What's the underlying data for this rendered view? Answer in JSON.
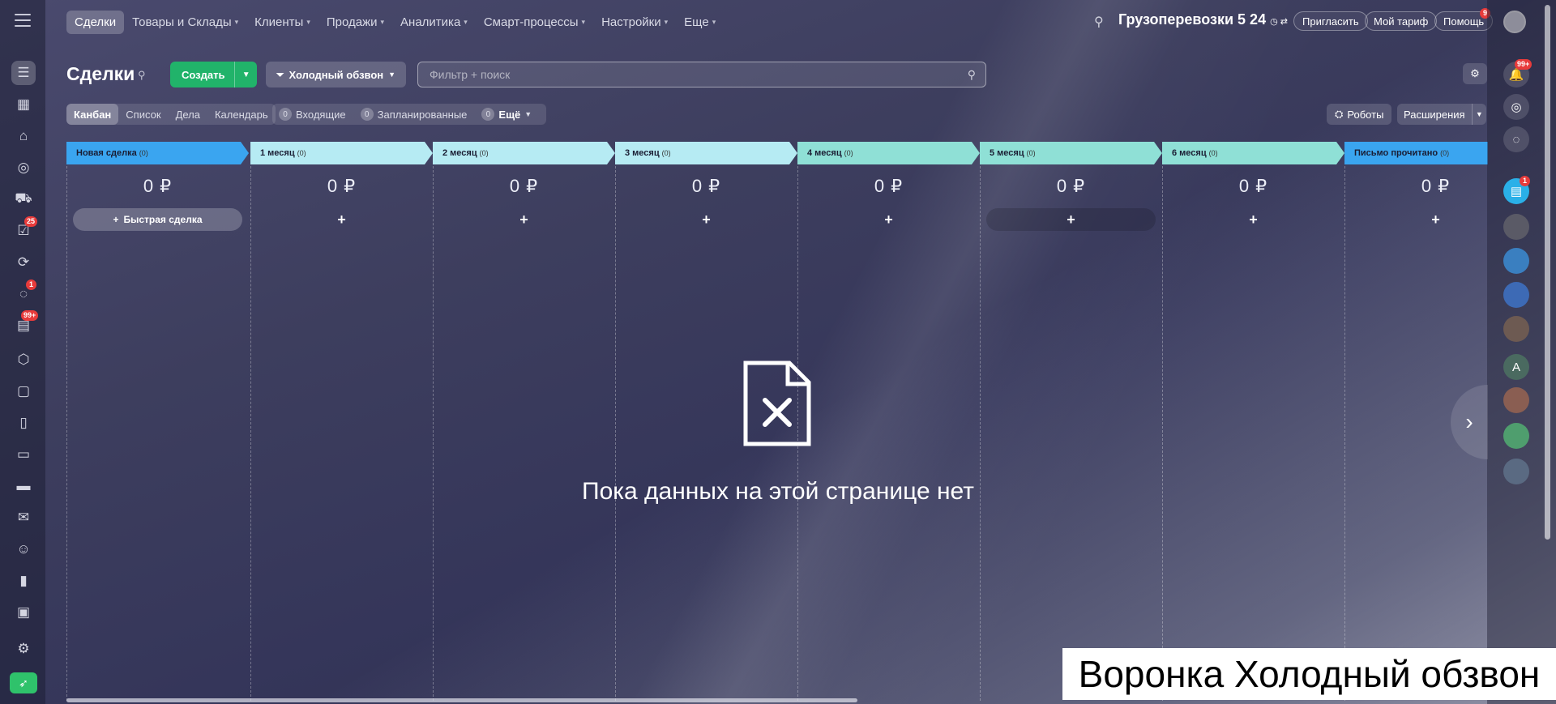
{
  "colors": {
    "accent_green": "#21b36a",
    "badge_red": "#e83b3b",
    "stage_blue": "#3aa5f0",
    "stage_light": "#b6ebf3",
    "stage_teal": "#8fe0d6"
  },
  "sidebar_badges": {
    "tasks": "25",
    "chat": "1",
    "feed": "99+"
  },
  "topnav": [
    {
      "label": "Сделки",
      "active": true
    },
    {
      "label": "Товары и Склады"
    },
    {
      "label": "Клиенты"
    },
    {
      "label": "Продажи"
    },
    {
      "label": "Аналитика"
    },
    {
      "label": "Смарт-процессы"
    },
    {
      "label": "Настройки"
    },
    {
      "label": "Еще"
    }
  ],
  "header": {
    "company": "Грузоперевозки 5 24",
    "invite": "Пригласить",
    "tariff": "Мой тариф",
    "help": "Помощь",
    "help_badge": "9",
    "notif_badge": "99+"
  },
  "page": {
    "title": "Сделки",
    "create": "Создать",
    "funnel": "Холодный обзвон",
    "search_placeholder": "Фильтр + поиск"
  },
  "views": [
    "Канбан",
    "Список",
    "Дела",
    "Календарь"
  ],
  "counters": [
    {
      "num": "0",
      "label": "Входящие"
    },
    {
      "num": "0",
      "label": "Запланированные"
    },
    {
      "num": "0",
      "label": "Ещё"
    }
  ],
  "robots": "Роботы",
  "extensions": "Расширения",
  "stages": [
    {
      "name": "Новая сделка",
      "count": "(0)",
      "sum": "0 ₽",
      "color": "#3aa5f0",
      "add": "Быстрая сделка"
    },
    {
      "name": "1 месяц",
      "count": "(0)",
      "sum": "0 ₽",
      "color": "#b6ebf3",
      "add": "+"
    },
    {
      "name": "2 месяц",
      "count": "(0)",
      "sum": "0 ₽",
      "color": "#b6ebf3",
      "add": "+"
    },
    {
      "name": "3 месяц",
      "count": "(0)",
      "sum": "0 ₽",
      "color": "#b6ebf3",
      "add": "+"
    },
    {
      "name": "4 месяц",
      "count": "(0)",
      "sum": "0 ₽",
      "color": "#8fe0d6",
      "add": "+"
    },
    {
      "name": "5 месяц",
      "count": "(0)",
      "sum": "0 ₽",
      "color": "#8fe0d6",
      "add": "+"
    },
    {
      "name": "6 месяц",
      "count": "(0)",
      "sum": "0 ₽",
      "color": "#8fe0d6",
      "add": "+"
    },
    {
      "name": "Письмо прочитано",
      "count": "(0)",
      "sum": "0 ₽",
      "color": "#3aa5f0",
      "add": "+"
    }
  ],
  "empty_text": "Пока данных на этой странице нет",
  "caption": "Воронка Холодный обзвон",
  "right_rail_badge": "1",
  "avatar_letter": "A"
}
